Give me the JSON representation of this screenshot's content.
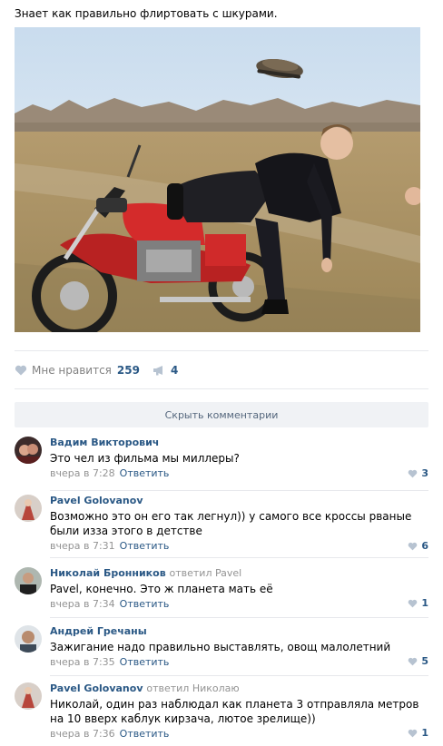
{
  "post": {
    "text": "Знает как правильно флиртовать с шкурами.",
    "likes_label": "Мне нравится",
    "likes_count": "259",
    "reposts_count": "4"
  },
  "hide_comments_label": "Скрыть комментарии",
  "comments": [
    {
      "author": "Вадим Викторович",
      "reply_to": "",
      "text": "Это чел из фильма мы миллеры?",
      "time": "вчера в 7:28",
      "reply_label": "Ответить",
      "likes": "3"
    },
    {
      "author": "Pavel Golovanov",
      "reply_to": "",
      "text": "Возможно это он его так легнул)) у самого все кроссы рваные были изза этого в детстве",
      "time": "вчера в 7:31",
      "reply_label": "Ответить",
      "likes": "6"
    },
    {
      "author": "Николай Бронников",
      "reply_to": "ответил Pavel",
      "text": "Pavel, конечно. Это ж планета мать её",
      "time": "вчера в 7:34",
      "reply_label": "Ответить",
      "likes": "1"
    },
    {
      "author": "Андрей Гречаны",
      "reply_to": "",
      "text": "Зажигание надо правильно выставлять, овощ малолетний",
      "time": "вчера в 7:35",
      "reply_label": "Ответить",
      "likes": "5"
    },
    {
      "author": "Pavel Golovanov",
      "reply_to": "ответил Николаю",
      "text": "Николай, один раз наблюдал как планета 3 отправляла метров на 10 вверх каблук кирзача, лютое зрелище))",
      "time": "вчера в 7:36",
      "reply_label": "Ответить",
      "likes": "1"
    }
  ]
}
